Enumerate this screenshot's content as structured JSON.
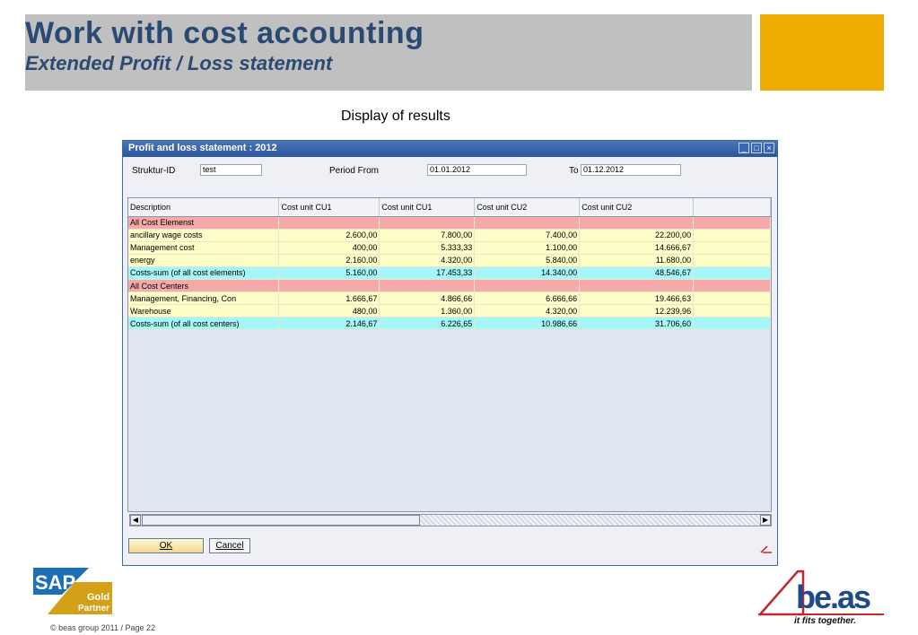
{
  "header": {
    "title": "Work with cost accounting",
    "subtitle": "Extended Profit / Loss statement"
  },
  "caption": "Display of results",
  "window": {
    "title": "Profit and loss statement : 2012",
    "controls": {
      "minimize": "_",
      "maximize": "□",
      "close": "×"
    },
    "fields": {
      "struktur_label": "Struktur-ID",
      "struktur_value": "test",
      "period_from_label": "Period From",
      "period_from_value": "01.01.2012",
      "to_label": "To",
      "to_value": "01.12.2012"
    },
    "table": {
      "columns": [
        "Description",
        "Cost unit CU1",
        "Cost unit CU1",
        "Cost unit CU2",
        "Cost unit CU2"
      ],
      "rows": [
        {
          "style": "red",
          "cells": [
            "All Cost Elemenst",
            "",
            "",
            "",
            ""
          ]
        },
        {
          "style": "yellow",
          "cells": [
            "ancillary wage costs",
            "2.600,00",
            "7.800,00",
            "7.400,00",
            "22.200,00"
          ]
        },
        {
          "style": "yellow",
          "cells": [
            "Management cost",
            "400,00",
            "5.333,33",
            "1.100,00",
            "14.666,67"
          ]
        },
        {
          "style": "yellow",
          "cells": [
            "energy",
            "2.160,00",
            "4.320,00",
            "5.840,00",
            "11.680,00"
          ]
        },
        {
          "style": "cyan",
          "cells": [
            "Costs-sum (of all cost elements)",
            "5.160,00",
            "17.453,33",
            "14.340,00",
            "48.546,67"
          ]
        },
        {
          "style": "red",
          "cells": [
            "All Cost Centers",
            "",
            "",
            "",
            ""
          ]
        },
        {
          "style": "yellow",
          "cells": [
            "Management, Financing, Con",
            "1.666,67",
            "4.866,66",
            "6.666,66",
            "19.466,63"
          ]
        },
        {
          "style": "yellow",
          "cells": [
            "Warehouse",
            "480,00",
            "1.360,00",
            "4.320,00",
            "12.239,96"
          ]
        },
        {
          "style": "cyan",
          "cells": [
            "Costs-sum (of all cost centers)",
            "2.146,67",
            "6.226,65",
            "10.986,66",
            "31.706,60"
          ]
        }
      ]
    },
    "buttons": {
      "ok": "OK",
      "cancel": "Cancel"
    }
  },
  "logos": {
    "sap_text": "SAP",
    "sap_gold": "Gold",
    "sap_partner": "Partner",
    "beas_text": "be.as",
    "beas_tagline": "it fits together."
  },
  "footer": "© beas group 2011 / Page 22",
  "colors": {
    "title_blue": "#2b4a73",
    "accent_orange": "#f0ab00",
    "row_red": "#f6a9a9",
    "row_yellow": "#fdfdc8",
    "row_cyan": "#a4f6f8"
  }
}
